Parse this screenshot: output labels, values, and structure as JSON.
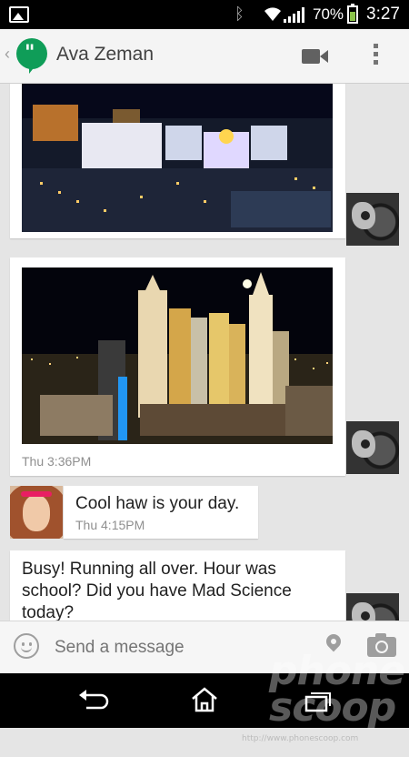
{
  "status_bar": {
    "battery_percent": "70%",
    "battery_level": 0.7,
    "time": "3:27",
    "icons": [
      "gallery-icon",
      "bluetooth-icon",
      "wifi-icon",
      "signal-icon",
      "battery-icon"
    ]
  },
  "action_bar": {
    "contact_name": "Ava Zeman",
    "app_logo_text": "\"",
    "icons": [
      "back-chevron-icon",
      "hangouts-logo-icon",
      "video-call-icon",
      "overflow-menu-icon"
    ]
  },
  "messages": [
    {
      "type": "photo",
      "direction": "incoming",
      "subject": "Las Vegas strip at night (Excalibur hotel)",
      "timestamp": ""
    },
    {
      "type": "photo",
      "direction": "incoming",
      "subject": "New York-New York hotel skyline at night",
      "timestamp": "Thu 3:36PM"
    },
    {
      "type": "text",
      "direction": "outgoing",
      "text": "Cool haw is your day.",
      "timestamp": "Thu 4:15PM"
    },
    {
      "type": "text",
      "direction": "incoming",
      "text_lines": [
        "Busy! Running all over. Hour was",
        "school? Did you have Mad Science",
        "today?"
      ]
    }
  ],
  "compose": {
    "placeholder": "Send a message",
    "icons": [
      "emoji-icon",
      "location-pin-icon",
      "camera-icon"
    ]
  },
  "nav_bar": {
    "icons": [
      "back-icon",
      "home-icon",
      "recent-apps-icon"
    ]
  },
  "watermark": {
    "line1": "phone",
    "line2": "scoop",
    "url": "http://www.phonescoop.com"
  }
}
